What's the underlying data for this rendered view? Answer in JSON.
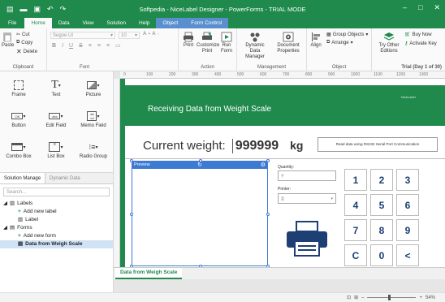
{
  "titlebar": {
    "title": "Softpedia - NiceLabel Designer - PowerForms - TRIAL MODE",
    "colors": {
      "brand": "#1f8a4c",
      "context": "#5a8fcf",
      "accent": "#3d7bd2",
      "trial": "#c00000"
    }
  },
  "tabs": [
    "File",
    "Home",
    "Data",
    "View",
    "Solution",
    "Help"
  ],
  "active_tab": "Home",
  "context_tabs": [
    "Object",
    "Form Control"
  ],
  "ribbon": {
    "clipboard": {
      "paste": "Paste",
      "cut": "Cut",
      "copy": "Copy",
      "delete": "Delete",
      "label": "Clipboard"
    },
    "font": {
      "face": "Segoe UI",
      "size": "10",
      "label": "Font"
    },
    "action": {
      "print": "Print",
      "customize_print": "Customize Print",
      "run_form": "Run Form",
      "label": "Action"
    },
    "management": {
      "dynamic_data": "Dynamic Data Manager",
      "document_properties": "Document Properties",
      "label": "Management"
    },
    "object": {
      "align": "Align",
      "group": "Group Objects",
      "arrange": "Arrange",
      "label": "Object"
    },
    "trial": {
      "try_other": "Try Other Editions",
      "buy_now": "Buy Now",
      "activate": "Activate Key",
      "status": "Trial (Day 1 of 30)"
    }
  },
  "toolbox": {
    "items": [
      "Frame",
      "Text",
      "Picture",
      "Button",
      "Edit Field",
      "Memo Field",
      "Combo Box",
      "List Box",
      "Radio Group"
    ]
  },
  "solution": {
    "tabs": [
      "Solution Manage",
      "Dynamic Data"
    ],
    "search_placeholder": "Search...",
    "tree": {
      "labels": "Labels",
      "add_label": "Add new label",
      "label": "Label",
      "forms": "Forms",
      "add_form": "Add new form",
      "form": "Data from Weigh Scale"
    }
  },
  "ruler": {
    "ticks": [
      "0",
      "100",
      "200",
      "300",
      "400",
      "500",
      "600",
      "700",
      "800",
      "900",
      "1000",
      "1100",
      "1200",
      "1300"
    ]
  },
  "form": {
    "header_title": "Receiving Data from Weight Scale",
    "header_logo": "NiceLabel",
    "weight_label": "Current weight:",
    "weight_value": "999999",
    "weight_unit": "kg",
    "read_button": "Read data using RS232 Serial Port Communication",
    "preview_label": "Preview",
    "quantity_label": "Quantity:",
    "quantity_value": "",
    "printer_label": "Printer:",
    "printer_value": "",
    "keys": [
      "1",
      "2",
      "3",
      "4",
      "5",
      "6",
      "7",
      "8",
      "9",
      "C",
      "0",
      "<"
    ]
  },
  "document_tab": "Data from Weigh Scale",
  "zoom": "54%"
}
